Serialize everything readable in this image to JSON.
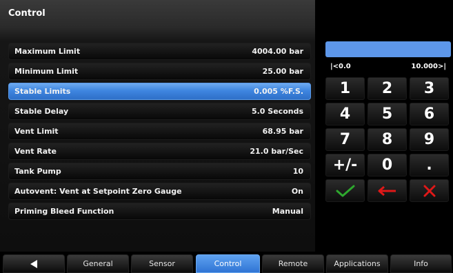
{
  "header": {
    "title": "Control"
  },
  "rows": [
    {
      "label": "Maximum Limit",
      "value": "4004.00 bar"
    },
    {
      "label": "Minimum Limit",
      "value": "25.00 bar"
    },
    {
      "label": "Stable Limits",
      "value": "0.005 %F.S."
    },
    {
      "label": "Stable Delay",
      "value": "5.0 Seconds"
    },
    {
      "label": "Vent Limit",
      "value": "68.95 bar"
    },
    {
      "label": "Vent Rate",
      "value": "21.0 bar/Sec"
    },
    {
      "label": "Tank Pump",
      "value": "10"
    },
    {
      "label": "Autovent: Vent at Setpoint Zero Gauge",
      "value": "On"
    },
    {
      "label": "Priming Bleed Function",
      "value": "Manual"
    }
  ],
  "keypad": {
    "display_value": "",
    "range_min": "|<0.0",
    "range_max": "10.000>|",
    "keys": [
      "1",
      "2",
      "3",
      "4",
      "5",
      "6",
      "7",
      "8",
      "9",
      "+/-",
      "0",
      "."
    ],
    "accept_icon": "check-icon",
    "backspace_icon": "left-arrow-icon",
    "cancel_icon": "x-icon"
  },
  "colors": {
    "accent": "#3f86e0",
    "accept": "#2ea82e",
    "cancel": "#e01818"
  },
  "tabs": {
    "back_icon": "back-arrow-icon",
    "items": [
      "General",
      "Sensor",
      "Control",
      "Remote",
      "Applications",
      "Info"
    ],
    "active": "Control"
  }
}
